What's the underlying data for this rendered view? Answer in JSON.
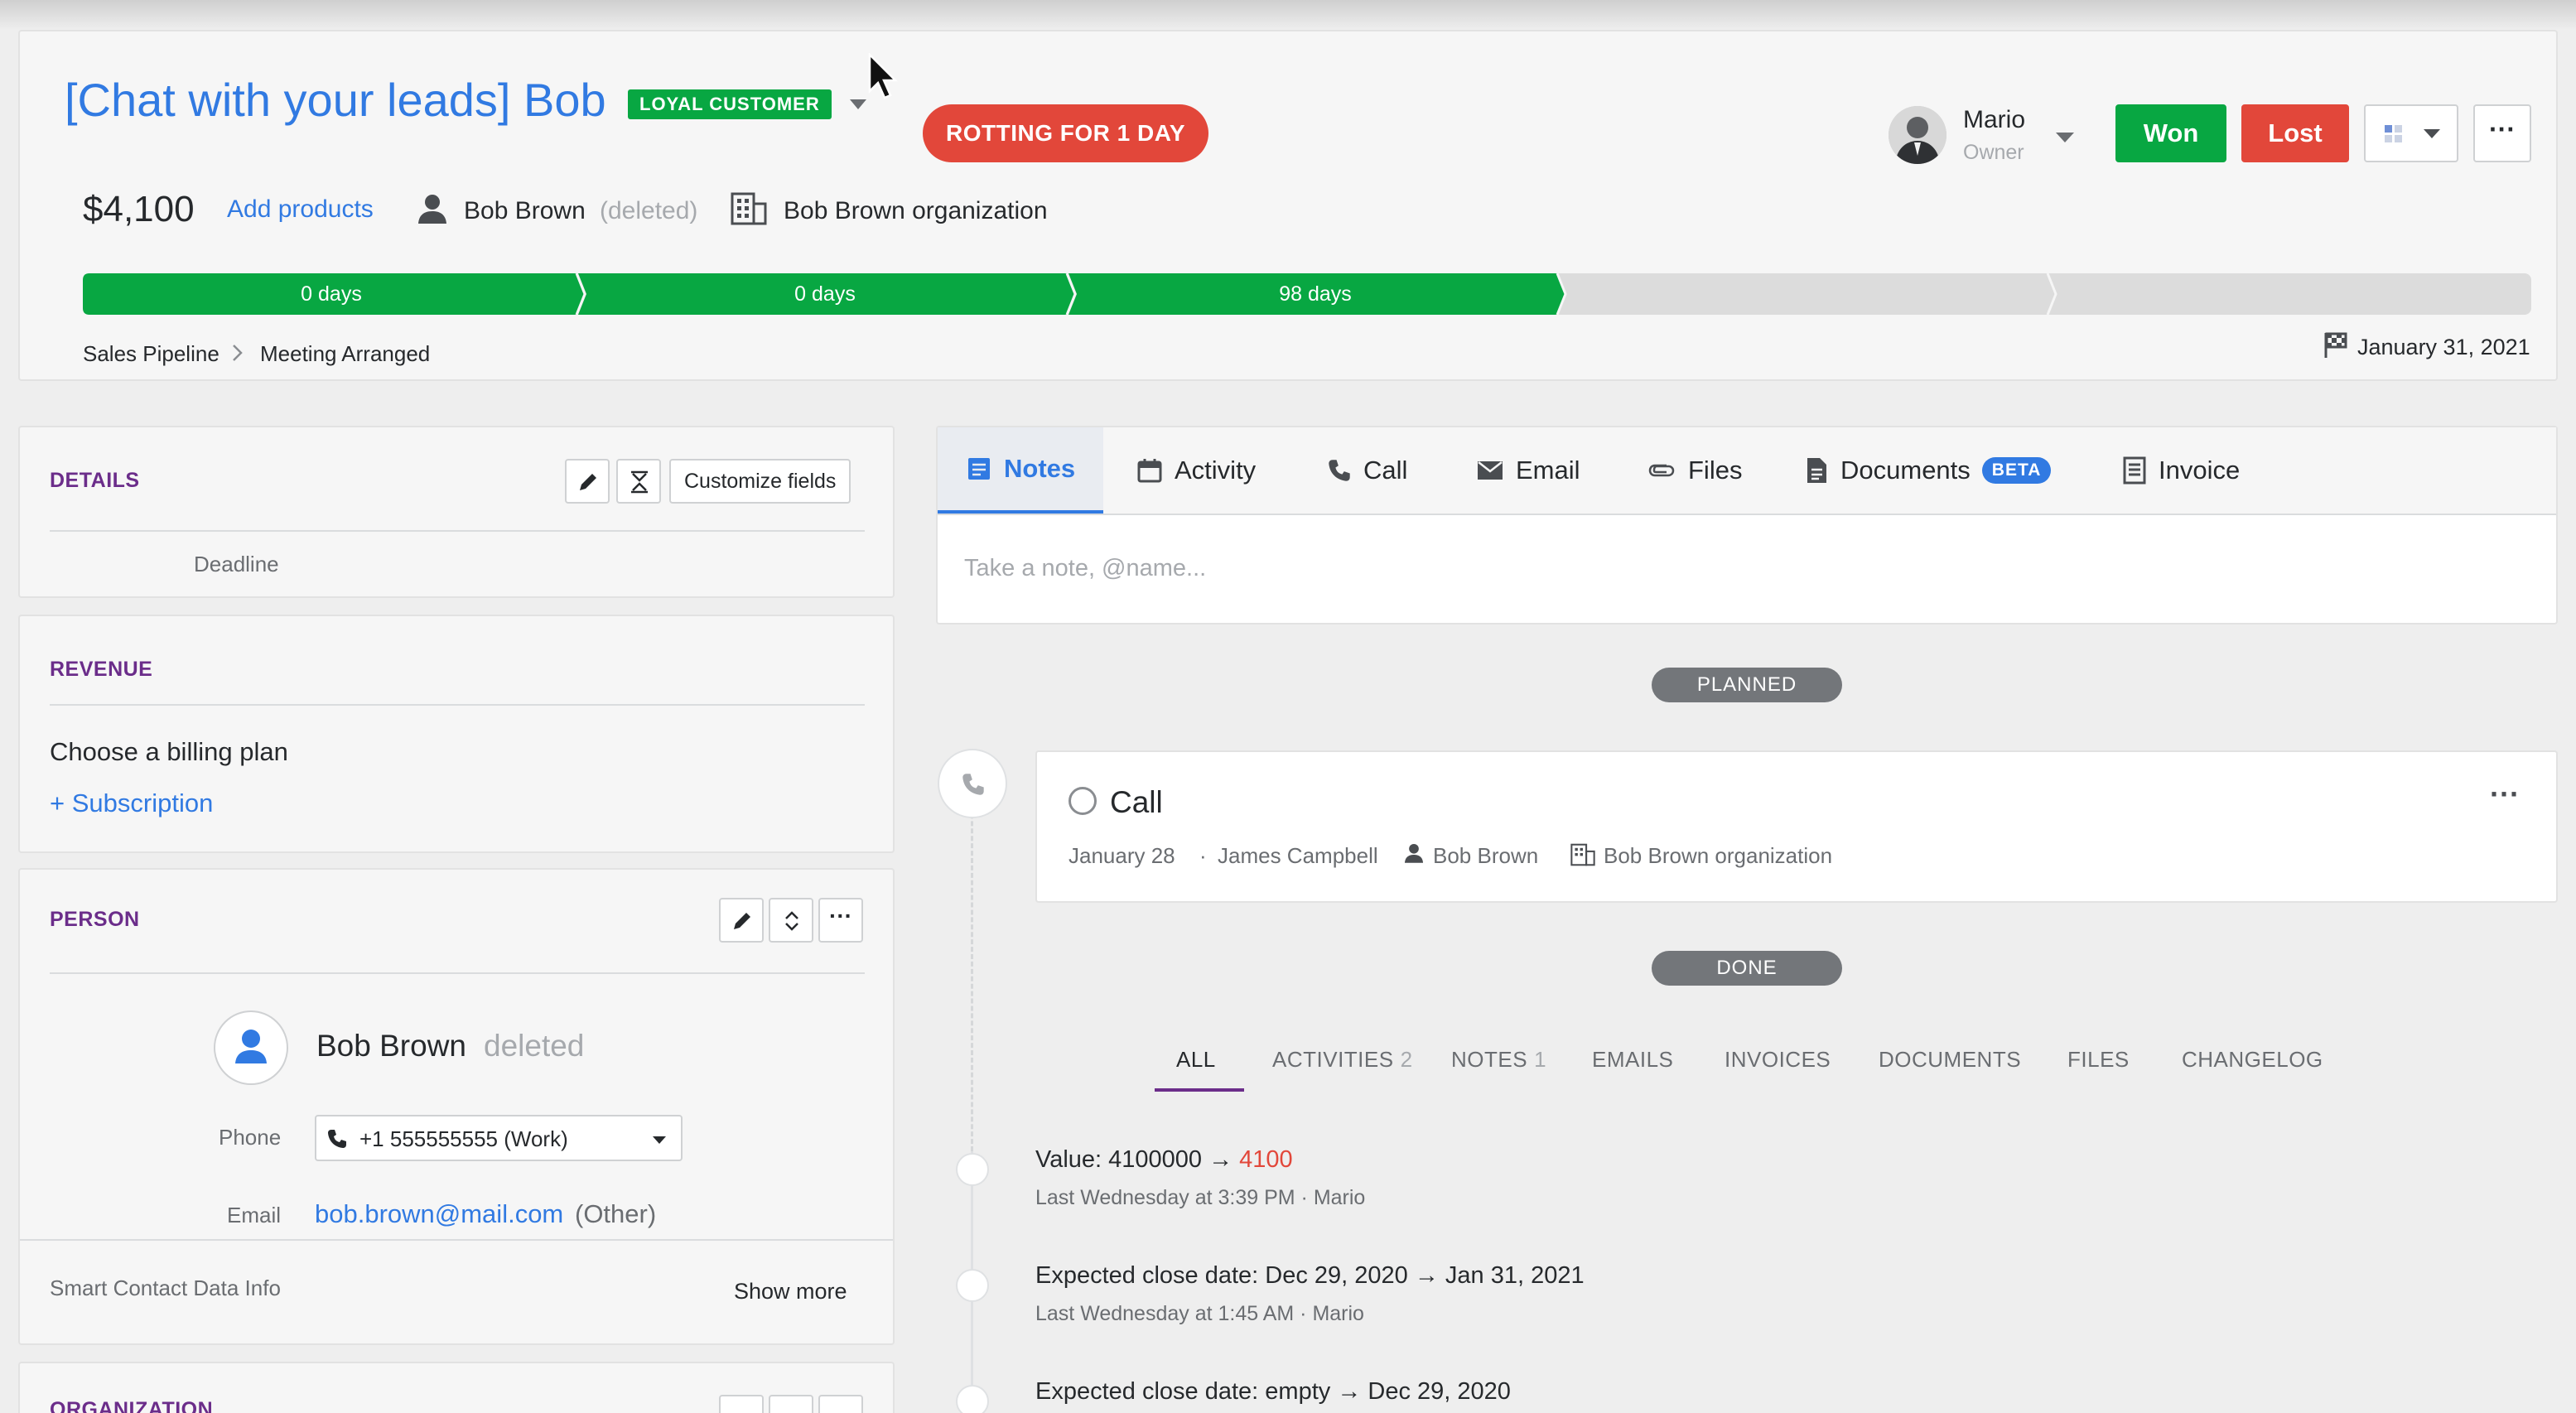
{
  "header": {
    "title": "[Chat with your leads] Bob",
    "badge": "LOYAL CUSTOMER",
    "rotting": "ROTTING FOR 1 DAY",
    "owner_name": "Mario",
    "owner_role": "Owner",
    "won_label": "Won",
    "lost_label": "Lost",
    "more_label": "···",
    "value": "$4,100",
    "add_products": "Add products",
    "person_name": "Bob Brown",
    "person_deleted": "(deleted)",
    "org_name": "Bob Brown organization",
    "stages": [
      {
        "label": "0 days",
        "state": "done"
      },
      {
        "label": "0 days",
        "state": "done"
      },
      {
        "label": "98 days",
        "state": "current"
      },
      {
        "label": "",
        "state": "todo"
      },
      {
        "label": "",
        "state": "todo"
      }
    ],
    "breadcrumb": [
      "Sales Pipeline",
      "Meeting Arranged"
    ],
    "expected_close": "January 31, 2021",
    "colors": {
      "accent": "#317ae2",
      "won": "#08a742",
      "lost": "#e2473a",
      "stage_done": "#08a742",
      "stage_todo": "#dcdcdc"
    }
  },
  "details": {
    "heading": "DETAILS",
    "customize": "Customize fields",
    "field_deadline": "Deadline"
  },
  "revenue": {
    "heading": "REVENUE",
    "billing": "Choose a billing plan",
    "subscription": "+ Subscription"
  },
  "person": {
    "heading": "PERSON",
    "name": "Bob Brown",
    "deleted": "deleted",
    "phone_label": "Phone",
    "phone_value": "+1 555555555 (Work)",
    "email_label": "Email",
    "email_value": "bob.brown@mail.com",
    "email_type": "(Other)",
    "smart_info": "Smart Contact Data Info",
    "show_more": "Show more",
    "more_label": "···"
  },
  "organization": {
    "heading": "ORGANIZATION"
  },
  "composer": {
    "tabs": [
      {
        "label": "Notes",
        "icon": "note-icon",
        "active": true
      },
      {
        "label": "Activity",
        "icon": "calendar-icon"
      },
      {
        "label": "Call",
        "icon": "phone-icon"
      },
      {
        "label": "Email",
        "icon": "envelope-icon"
      },
      {
        "label": "Files",
        "icon": "paperclip-icon"
      },
      {
        "label": "Documents",
        "icon": "document-icon",
        "badge": "BETA"
      },
      {
        "label": "Invoice",
        "icon": "invoice-icon"
      }
    ],
    "placeholder": "Take a note, @name..."
  },
  "timeline": {
    "planned_label": "PLANNED",
    "done_label": "DONE",
    "activity": {
      "title": "Call",
      "date": "January 28",
      "sep": "·",
      "assignee": "James Campbell",
      "person": "Bob Brown",
      "org": "Bob Brown organization",
      "more": "···"
    },
    "filters": [
      {
        "label": "ALL",
        "active": true
      },
      {
        "label": "ACTIVITIES",
        "count": "2"
      },
      {
        "label": "NOTES",
        "count": "1"
      },
      {
        "label": "EMAILS"
      },
      {
        "label": "INVOICES"
      },
      {
        "label": "DOCUMENTS"
      },
      {
        "label": "FILES"
      },
      {
        "label": "CHANGELOG"
      }
    ],
    "changes": [
      {
        "old": "Value: 4100000 → ",
        "new": "4100",
        "meta": "Last Wednesday at 3:39 PM   ·  Mario"
      },
      {
        "old": "Expected close date: Dec 29, 2020 → Jan 31, 2021",
        "new": "",
        "meta": "Last Wednesday at 1:45 AM   ·  Mario"
      },
      {
        "old": "Expected close date: empty → Dec 29, 2020",
        "new": "",
        "meta": ""
      }
    ]
  }
}
